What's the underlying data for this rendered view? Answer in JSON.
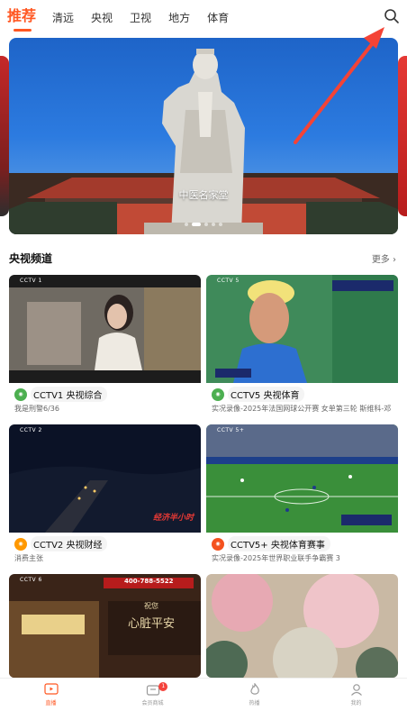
{
  "tabs": [
    {
      "label": "推荐",
      "active": true
    },
    {
      "label": "清远",
      "active": false
    },
    {
      "label": "央视",
      "active": false
    },
    {
      "label": "卫视",
      "active": false
    },
    {
      "label": "地方",
      "active": false
    },
    {
      "label": "体育",
      "active": false
    }
  ],
  "search_icon": "search-icon",
  "banner": {
    "caption": "中医名家堂",
    "current_slide": 1,
    "slide_count": 5
  },
  "section": {
    "title": "央视频道",
    "more": "更多 ›"
  },
  "channels": [
    {
      "logo": "CCTV 1",
      "name": "CCTV1 央视综合",
      "program": "我是刑警6/36",
      "icon_color": "#4caf50"
    },
    {
      "logo": "CCTV 5",
      "name": "CCTV5 央视体育",
      "program": "实况录像-2025年法国网球公开赛 女单第三轮 斯维科-邓",
      "icon_color": "#4caf50"
    },
    {
      "logo": "CCTV 2",
      "name": "CCTV2 央视财经",
      "program": "消费主张",
      "icon_color": "#ff9800"
    },
    {
      "logo": "CCTV 5+",
      "name": "CCTV5+ 央视体育赛事",
      "program": "实况录像-2025年世界职业联手争霸赛 3",
      "icon_color": "#f4511e"
    },
    {
      "logo": "CCTV 6",
      "name": "",
      "program": "",
      "icon_color": ""
    },
    {
      "logo": "",
      "name": "",
      "program": "",
      "icon_color": ""
    }
  ],
  "overlays": {
    "cctv2_logo_text": "经济半小时",
    "cctv6_phone": "400-788-5522",
    "cctv6_slogan1": "祝您",
    "cctv6_slogan2": "心脏平安"
  },
  "bottom_nav": [
    {
      "label": "直播",
      "icon": "tv-icon",
      "active": true
    },
    {
      "label": "会员商城",
      "icon": "shop-icon",
      "active": false,
      "badge": "1"
    },
    {
      "label": "热播",
      "icon": "fire-icon",
      "active": false
    },
    {
      "label": "我的",
      "icon": "user-icon",
      "active": false
    }
  ],
  "colors": {
    "accent": "#ff5722",
    "annotation_arrow": "#f44336"
  }
}
